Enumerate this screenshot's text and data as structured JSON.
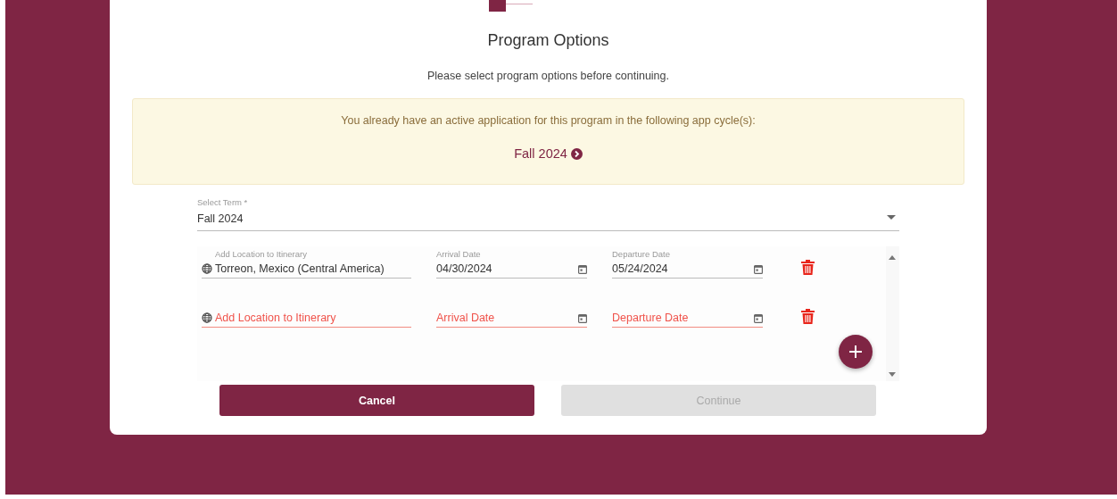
{
  "dialog": {
    "title": "Program Options",
    "subtitle": "Please select program options before continuing."
  },
  "alert": {
    "message": "You already have an active application for this program in the following app cycle(s):",
    "cycle_link": "Fall 2024"
  },
  "term_select": {
    "label": "Select Term *",
    "value": "Fall 2024"
  },
  "itinerary": [
    {
      "location": {
        "label": "Add Location to Itinerary",
        "value": "Torreon, Mexico (Central America)",
        "invalid": false
      },
      "arrival": {
        "label": "Arrival Date",
        "value": "04/30/2024",
        "invalid": false
      },
      "departure": {
        "label": "Departure Date",
        "value": "05/24/2024",
        "invalid": false
      }
    },
    {
      "location": {
        "placeholder": "Add Location to Itinerary",
        "invalid": true
      },
      "arrival": {
        "placeholder": "Arrival Date",
        "invalid": true
      },
      "departure": {
        "placeholder": "Departure Date",
        "invalid": true
      }
    }
  ],
  "buttons": [
    {
      "label": "Cancel",
      "disabled": false
    },
    {
      "label": "Continue",
      "disabled": true
    }
  ]
}
